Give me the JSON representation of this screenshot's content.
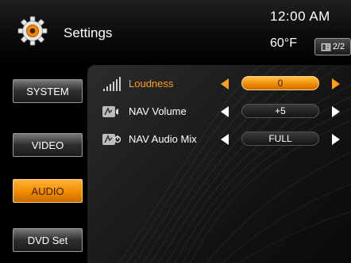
{
  "header": {
    "title": "Settings",
    "icon": "gear-icon",
    "time": "12:00 AM",
    "temperature": "60°F",
    "page_indicator": "2/2",
    "page_icon": "menu-list-icon"
  },
  "tabs": [
    {
      "label": "SYSTEM",
      "active": false
    },
    {
      "label": "VIDEO",
      "active": false
    },
    {
      "label": "AUDIO",
      "active": true
    },
    {
      "label": "DVD Set",
      "active": false
    }
  ],
  "settings": [
    {
      "label": "Loudness",
      "value": "0",
      "icon": "loudness-icon",
      "active": true
    },
    {
      "label": "NAV Volume",
      "value": "+5",
      "icon": "nav-volume-icon",
      "active": false
    },
    {
      "label": "NAV Audio Mix",
      "value": "FULL",
      "icon": "nav-audio-mix-icon",
      "active": false
    }
  ],
  "colors": {
    "accent": "#f08c00",
    "active_text": "#ff9f1a",
    "background": "#000000"
  }
}
